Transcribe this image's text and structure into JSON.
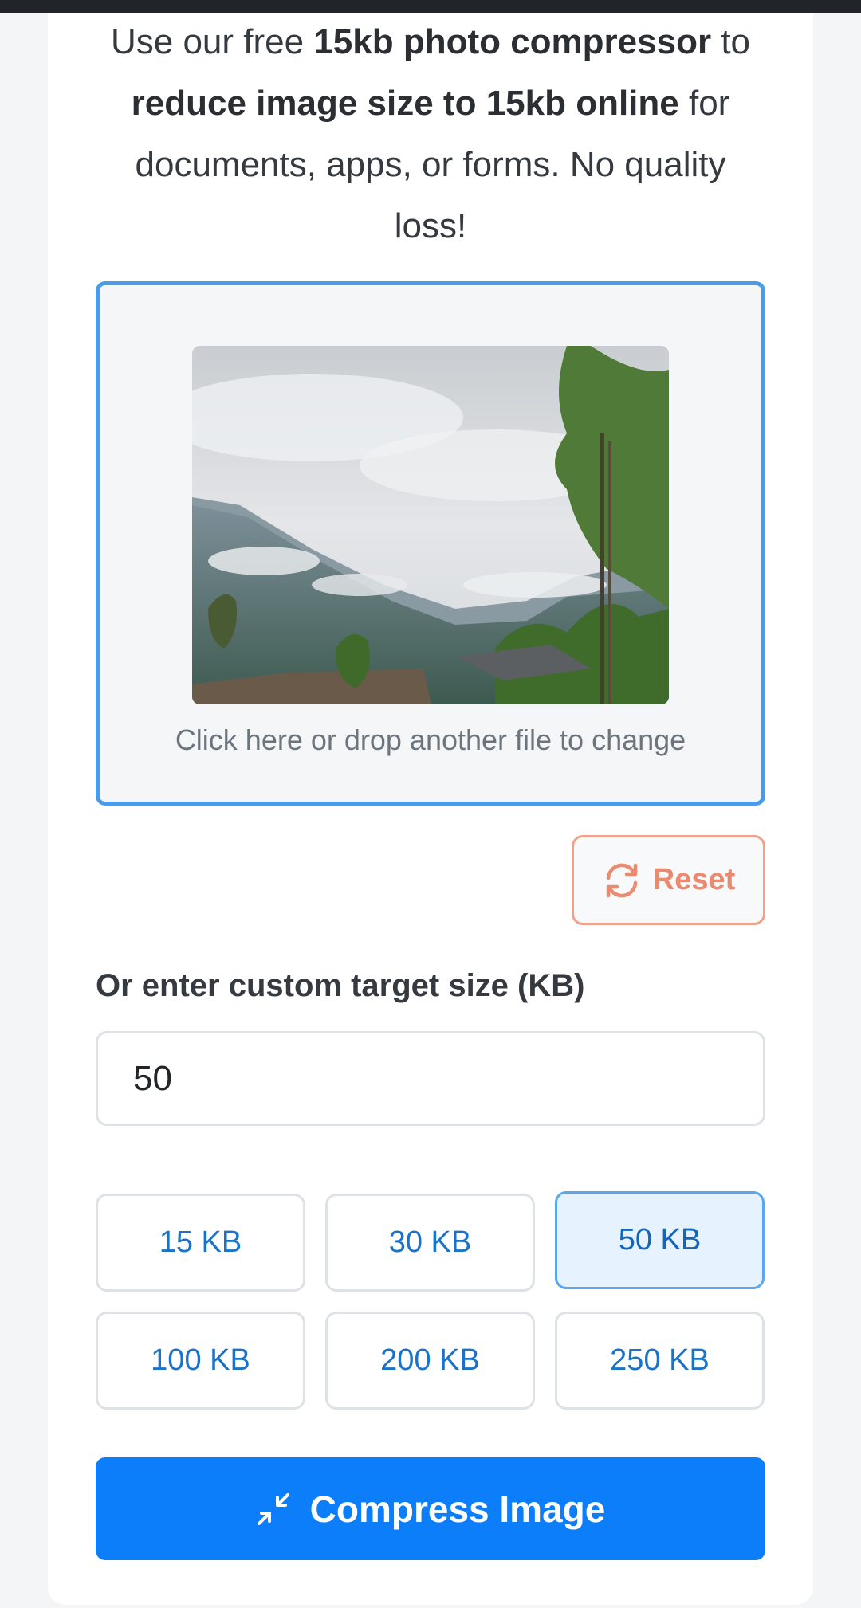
{
  "intro": {
    "t1": "Use our free ",
    "b1": "15kb photo compressor",
    "t2": " to ",
    "b2": "reduce image size to 15kb online",
    "t3": " for documents, apps, or forms. No quality loss!"
  },
  "dropzone": {
    "hint": "Click here or drop another file to change"
  },
  "reset": {
    "label": "Reset",
    "icon": "refresh-icon",
    "color": "#ea8a70"
  },
  "custom": {
    "label": "Or enter custom target size (KB)",
    "value": "50"
  },
  "presets": [
    {
      "label": "15 KB",
      "active": false
    },
    {
      "label": "30 KB",
      "active": false
    },
    {
      "label": "50 KB",
      "active": true
    },
    {
      "label": "100 KB",
      "active": false
    },
    {
      "label": "200 KB",
      "active": false
    },
    {
      "label": "250 KB",
      "active": false
    }
  ],
  "compress": {
    "label": "Compress Image",
    "icon": "compress-arrows-icon",
    "color": "#0d7ef9"
  }
}
